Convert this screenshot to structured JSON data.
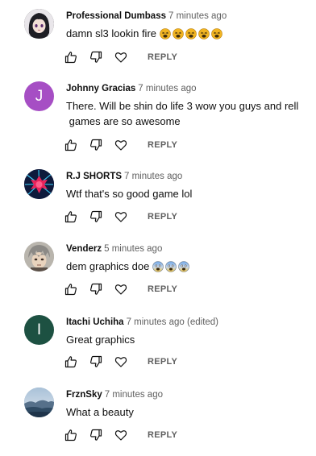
{
  "comments": [
    {
      "author": "Professional Dumbass",
      "time": "7 minutes ago",
      "text": "damn sl3 lookin fire",
      "emojis": [
        "tired-face",
        "tired-face",
        "tired-face",
        "tired-face",
        "tired-face"
      ],
      "avatar": {
        "type": "anime-girl",
        "color": "#2b2b2b"
      },
      "reply_label": "REPLY"
    },
    {
      "author": "Johnny Gracias",
      "time": "7 minutes ago",
      "text": "There. Will be shin do life 3 wow you guys and rell\n games are so awesome",
      "emojis": [],
      "avatar": {
        "type": "letter",
        "letter": "J",
        "color": "#a64ec4"
      },
      "reply_label": "REPLY"
    },
    {
      "author": "R.J SHORTS",
      "time": "7 minutes ago",
      "text": "Wtf that's so good game lol",
      "emojis": [],
      "avatar": {
        "type": "neon-burst",
        "color": "#10204a"
      },
      "reply_label": "REPLY"
    },
    {
      "author": "Venderz",
      "time": "5 minutes ago",
      "text": "dem graphics doe",
      "emojis": [
        "fearful-face",
        "fearful-face",
        "fearful-face"
      ],
      "avatar": {
        "type": "anime-boy",
        "color": "#a8a39a"
      },
      "reply_label": "REPLY"
    },
    {
      "author": "Itachi Uchiha",
      "time": "7 minutes ago (edited)",
      "text": "Great graphics",
      "emojis": [],
      "avatar": {
        "type": "letter",
        "letter": "I",
        "color": "#1d5142"
      },
      "reply_label": "REPLY"
    },
    {
      "author": "FrznSky",
      "time": "7 minutes ago",
      "text": "What a beauty",
      "emojis": [],
      "avatar": {
        "type": "landscape",
        "color": "#6f8fae"
      },
      "reply_label": "REPLY"
    }
  ],
  "icons": {
    "like": "thumb-up-icon",
    "dislike": "thumb-down-icon",
    "heart": "heart-icon"
  },
  "colors": {
    "text": "#0f0f0f",
    "secondary": "#606060",
    "icon": "#0f0f0f"
  }
}
